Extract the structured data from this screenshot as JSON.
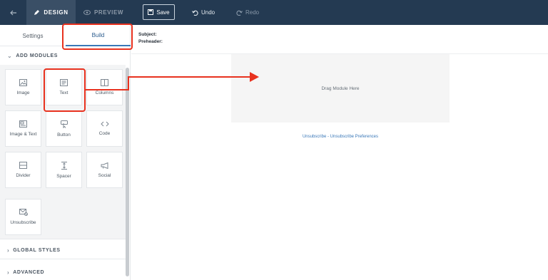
{
  "topbar": {
    "back_icon": "arrow-left-icon",
    "design_label": "DESIGN",
    "preview_label": "PREVIEW",
    "save_label": "Save",
    "undo_label": "Undo",
    "redo_label": "Redo"
  },
  "sidebar": {
    "tabs": [
      {
        "label": "Settings"
      },
      {
        "label": "Build"
      }
    ],
    "add_modules_label": "ADD MODULES",
    "modules": [
      {
        "label": "Image",
        "icon": "image-icon"
      },
      {
        "label": "Text",
        "icon": "text-icon"
      },
      {
        "label": "Columns",
        "icon": "columns-icon"
      },
      {
        "label": "Image & Text",
        "icon": "image-text-icon"
      },
      {
        "label": "Button",
        "icon": "button-pointer-icon"
      },
      {
        "label": "Code",
        "icon": "code-icon"
      },
      {
        "label": "Divider",
        "icon": "divider-icon"
      },
      {
        "label": "Spacer",
        "icon": "spacer-icon"
      },
      {
        "label": "Social",
        "icon": "megaphone-icon"
      },
      {
        "label": "Unsubscribe",
        "icon": "unsubscribe-icon"
      }
    ],
    "global_styles_label": "GLOBAL STYLES",
    "advanced_label": "ADVANCED"
  },
  "main": {
    "subject_label": "Subject:",
    "preheader_label": "Preheader:",
    "drop_zone_text": "Drag Module Here",
    "unsubscribe_link": "Unsubscribe",
    "separator": " - ",
    "preferences_link": "Unsubscribe Preferences"
  },
  "colors": {
    "topbar_bg": "#243a52",
    "accent": "#3a78b8",
    "annotation": "#e8321f"
  }
}
